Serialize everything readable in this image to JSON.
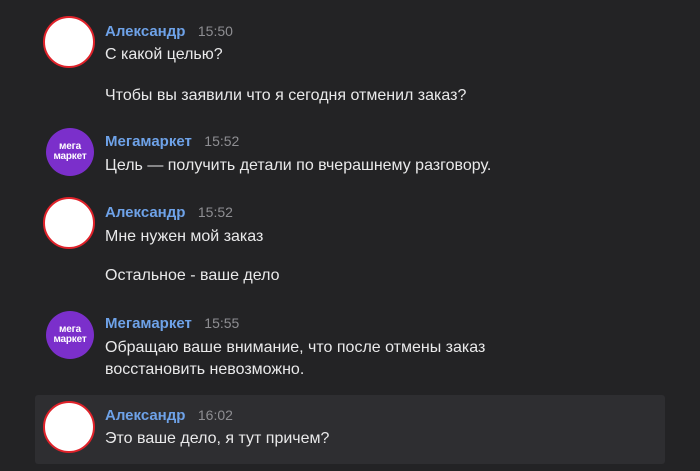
{
  "messages": [
    {
      "author": "Александр",
      "time": "15:50",
      "lines": [
        "С какой целью?",
        "Чтобы вы заявили что я сегодня отменил заказ?"
      ]
    },
    {
      "author": "Мегамаркет",
      "time": "15:52",
      "logo_top": "мега",
      "logo_bottom": "маркет",
      "lines": [
        "Цель — получить детали по вчерашнему разговору."
      ]
    },
    {
      "author": "Александр",
      "time": "15:52",
      "lines": [
        "Мне нужен мой заказ",
        "Остальное - ваше дело"
      ]
    },
    {
      "author": "Мегамаркет",
      "time": "15:55",
      "logo_top": "мега",
      "logo_bottom": "маркет",
      "lines": [
        "Обращаю ваше внимание, что после отмены заказ",
        "восстановить невозможно."
      ]
    },
    {
      "author": "Александр",
      "time": "16:02",
      "lines": [
        "Это ваше дело, я тут причем?"
      ]
    }
  ],
  "colors": {
    "background": "#232325",
    "highlight": "#2e2e31",
    "author_name": "#6ea2e8",
    "brand_avatar": "#7b2fcb",
    "user_avatar_border": "#e0222a"
  }
}
